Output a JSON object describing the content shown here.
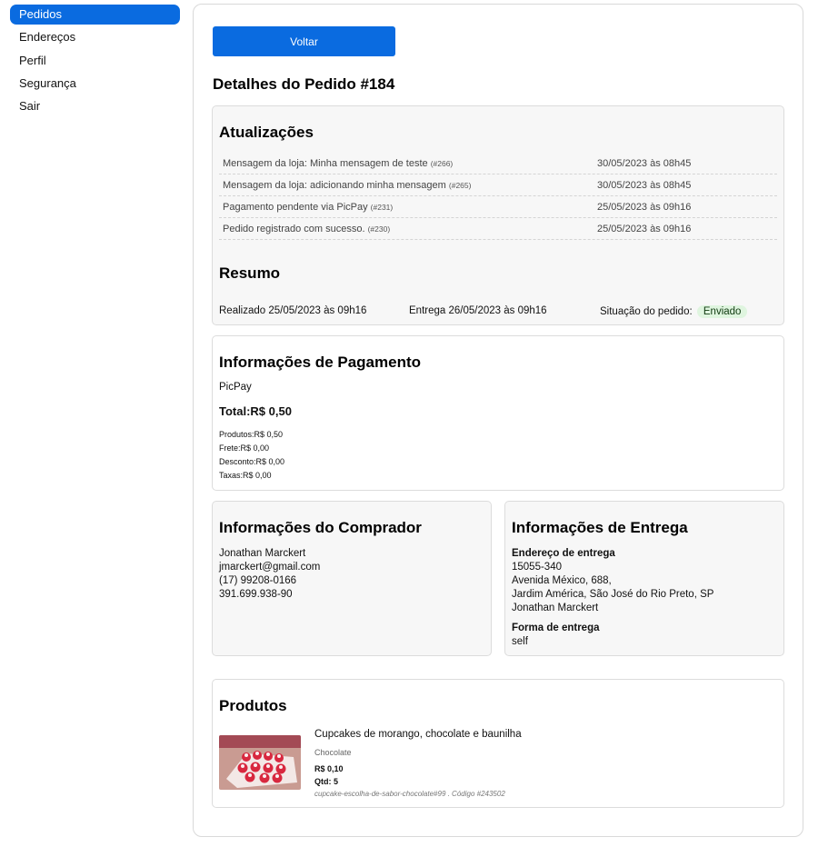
{
  "sidebar": {
    "items": [
      {
        "label": "Pedidos",
        "active": true
      },
      {
        "label": "Endereços"
      },
      {
        "label": "Perfil"
      },
      {
        "label": "Segurança"
      },
      {
        "label": "Sair"
      }
    ]
  },
  "main": {
    "back_label": "Voltar",
    "title": "Detalhes do Pedido #184"
  },
  "updates": {
    "title": "Atualizações",
    "rows": [
      {
        "message": "Mensagem da loja: Minha mensagem de teste",
        "code": "(#266)",
        "date": "30/05/2023 às 08h45"
      },
      {
        "message": "Mensagem da loja: adicionando minha mensagem",
        "code": "(#265)",
        "date": "30/05/2023 às 08h45"
      },
      {
        "message": "Pagamento pendente via PicPay",
        "code": "(#231)",
        "date": "25/05/2023 às 09h16"
      },
      {
        "message": "Pedido registrado com sucesso.",
        "code": "(#230)",
        "date": "25/05/2023 às 09h16"
      }
    ]
  },
  "summary": {
    "title": "Resumo",
    "placed": "Realizado 25/05/2023 às 09h16",
    "delivery": "Entrega 26/05/2023 às 09h16",
    "status_label": "Situação do pedido:",
    "status_value": "Enviado",
    "status_color": "#dff5df"
  },
  "payment": {
    "title": "Informações de Pagamento",
    "method": "PicPay",
    "total": "Total:R$ 0,50",
    "lines": [
      "Produtos:R$ 0,50",
      "Frete:R$ 0,00",
      "Desconto:R$ 0,00",
      "Taxas:R$ 0,00"
    ]
  },
  "buyer": {
    "title": "Informações do Comprador",
    "name": "Jonathan Marckert",
    "email": "jmarckert@gmail.com",
    "phone": "(17) 99208-0166",
    "document": "391.699.938-90"
  },
  "delivery": {
    "title": "Informações de Entrega",
    "address_label": "Endereço de entrega",
    "zip": "15055-340",
    "street": "Avenida México, 688,",
    "city": "Jardim América, São José do Rio Preto, SP",
    "recipient": "Jonathan Marckert",
    "method_label": "Forma de entrega",
    "method": "self"
  },
  "products": {
    "title": "Produtos",
    "items": [
      {
        "name": "Cupcakes de morango, chocolate e baunilha",
        "variant": "Chocolate",
        "price": "R$ 0,10",
        "qty": "Qtd: 5",
        "sku": "cupcake-escolha-de-sabor-chocolate#99 . Código #243502",
        "image_icon": "cupcakes-photo"
      }
    ]
  },
  "colors": {
    "accent": "#0a6be0",
    "card_grey": "#f7f7f7",
    "border": "#dcdcdc"
  }
}
